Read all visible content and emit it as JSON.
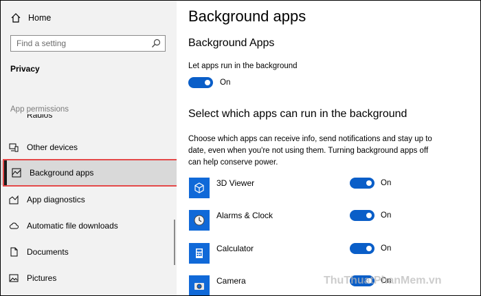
{
  "sidebar": {
    "home_label": "Home",
    "search_placeholder": "Find a setting",
    "section_title": "Privacy",
    "app_permissions_header": "App permissions",
    "partial_item": "Radios",
    "items": [
      {
        "label": "Other devices",
        "icon": "other-devices-icon"
      },
      {
        "label": "Background apps",
        "icon": "background-apps-icon",
        "selected": true
      },
      {
        "label": "App diagnostics",
        "icon": "app-diagnostics-icon"
      },
      {
        "label": "Automatic file downloads",
        "icon": "cloud-icon"
      },
      {
        "label": "Documents",
        "icon": "document-icon"
      },
      {
        "label": "Pictures",
        "icon": "pictures-icon"
      }
    ]
  },
  "main": {
    "page_title": "Background apps",
    "section1_title": "Background Apps",
    "toggle_label": "Let apps run in the background",
    "toggle_state": "On",
    "section2_title": "Select which apps can run in the background",
    "description": "Choose which apps can receive info, send notifications and stay up to date, even when you're not using them. Turning background apps off can help conserve power.",
    "apps": [
      {
        "name": "3D Viewer",
        "state": "On",
        "icon": "cube-icon"
      },
      {
        "name": "Alarms & Clock",
        "state": "On",
        "icon": "clock-icon"
      },
      {
        "name": "Calculator",
        "state": "On",
        "icon": "calculator-icon"
      },
      {
        "name": "Camera",
        "state": "On",
        "icon": "camera-icon"
      }
    ]
  },
  "colors": {
    "accent": "#0a5ec8",
    "sidebar_bg": "#f2f2f2",
    "highlight_border": "#e44848"
  },
  "watermark": "ThuThuatPhanMem.vn"
}
